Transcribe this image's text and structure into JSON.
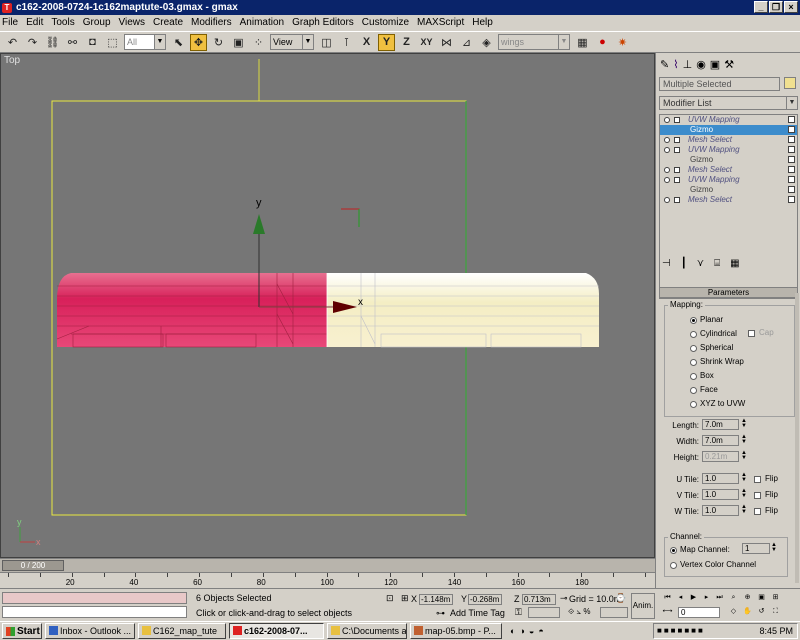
{
  "window": {
    "title": "c162-2008-0724-1c162maptute-03.gmax - gmax"
  },
  "menu": [
    "File",
    "Edit",
    "Tools",
    "Group",
    "Views",
    "Create",
    "Modifiers",
    "Animation",
    "Graph Editors",
    "Customize",
    "MAXScript",
    "Help"
  ],
  "toolbar": {
    "selection_filter": "All",
    "ref_coord": "View",
    "named_selection": "wings",
    "icons": [
      "undo-icon",
      "redo-icon",
      "link-icon",
      "unlink-icon",
      "select-icon",
      "select-region-icon",
      "select-by-name-icon",
      "move-icon",
      "rotate-icon",
      "scale-icon",
      "pivot-icon",
      "mirror-icon",
      "x-axis-icon",
      "y-axis-icon",
      "z-axis-icon",
      "xy-axis-icon",
      "snap-icon",
      "angle-snap-icon",
      "percent-snap-icon",
      "material-editor-icon",
      "render-icon"
    ]
  },
  "viewport": {
    "label": "Top",
    "gizmo_y_label": "y",
    "gizmo_x_label": "x",
    "axis_y": "y",
    "axis_x": "x"
  },
  "command_panel": {
    "selection_name": "Multiple Selected",
    "modifier_list": "Modifier List",
    "stack": [
      {
        "label": "UVW Mapping",
        "kind": "mod"
      },
      {
        "label": "Gizmo",
        "kind": "sub",
        "selected": true
      },
      {
        "label": "Mesh Select",
        "kind": "mod"
      },
      {
        "label": "UVW Mapping",
        "kind": "mod"
      },
      {
        "label": "Gizmo",
        "kind": "sub"
      },
      {
        "label": "Mesh Select",
        "kind": "mod"
      },
      {
        "label": "UVW Mapping",
        "kind": "mod"
      },
      {
        "label": "Gizmo",
        "kind": "sub"
      },
      {
        "label": "Mesh Select",
        "kind": "mod"
      }
    ],
    "parameters": {
      "rollout_title": "Parameters",
      "mapping_title": "Mapping:",
      "mapping_options": [
        "Planar",
        "Cylindrical",
        "Spherical",
        "Shrink Wrap",
        "Box",
        "Face",
        "XYZ to UVW"
      ],
      "mapping_selected": "Planar",
      "cap_label": "Cap",
      "length_label": "Length:",
      "length": "7.0m",
      "width_label": "Width:",
      "width": "7.0m",
      "height_label": "Height:",
      "height": "0.21m",
      "u_tile_label": "U Tile:",
      "u_tile": "1.0",
      "v_tile_label": "V Tile:",
      "v_tile": "1.0",
      "w_tile_label": "W Tile:",
      "w_tile": "1.0",
      "flip_label": "Flip",
      "channel_title": "Channel:",
      "map_channel_label": "Map Channel:",
      "map_channel": "1",
      "vertex_color_label": "Vertex Color Channel",
      "channel_selected": "Map Channel:"
    }
  },
  "timeline": {
    "slider_label": "0 / 200",
    "ticks": [
      0,
      10,
      20,
      30,
      40,
      50,
      60,
      70,
      80,
      90,
      100,
      110,
      120,
      130,
      140,
      150,
      160,
      170,
      180,
      190,
      200
    ],
    "labels": [
      "20",
      "40",
      "60",
      "80",
      "100",
      "120",
      "140",
      "160",
      "180"
    ]
  },
  "status": {
    "selection": "6 Objects Selected",
    "prompt": "Click or click-and-drag to select objects",
    "x_label": "X",
    "x": "-1.148m",
    "y_label": "Y",
    "y": "-0.268m",
    "z_label": "Z",
    "z": "0.713m",
    "grid": "Grid = 10.0m",
    "add_time_tag": "Add Time Tag",
    "anim_label": "Anim.",
    "frame": "0"
  },
  "taskbar": {
    "start": "Start",
    "tasks": [
      {
        "label": "Inbox - Outlook ...",
        "active": false
      },
      {
        "label": "C162_map_tute",
        "active": false
      },
      {
        "label": "c162-2008-07...",
        "active": true
      },
      {
        "label": "C:\\Documents a...",
        "active": false
      },
      {
        "label": "map-05.bmp - P...",
        "active": false
      }
    ],
    "clock": "8:45 PM"
  },
  "colors": {
    "viewport_bg": "#767676",
    "selection_yellow": "#e8e840",
    "fuselage_red": "#d8205a",
    "fuselage_cream": "#f4eec4",
    "titlebar": "#0a246a",
    "stack_highlight": "#3c8ccc"
  }
}
